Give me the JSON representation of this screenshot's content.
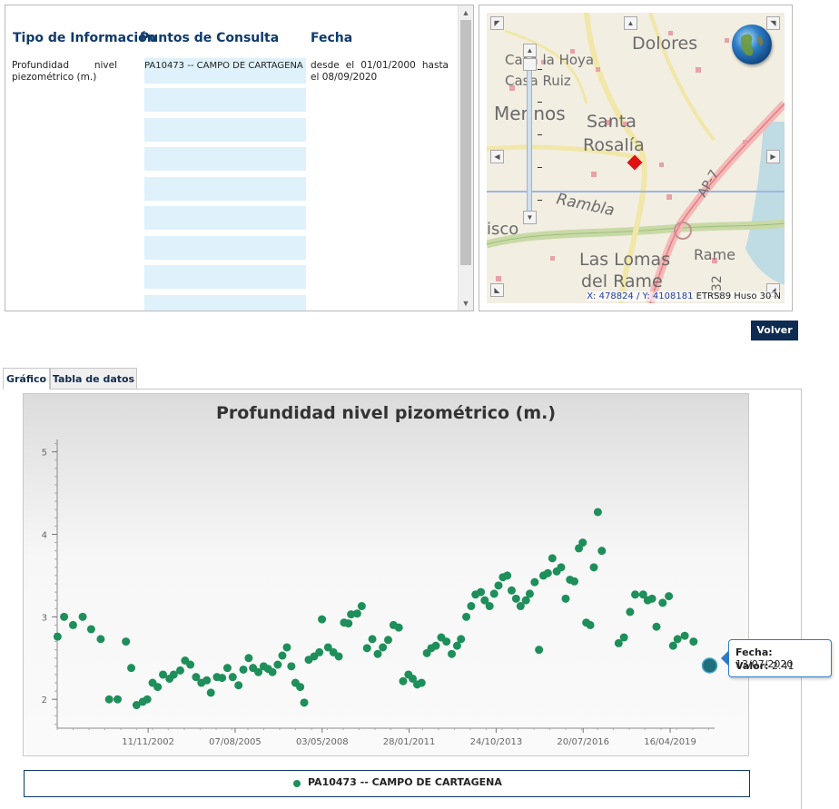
{
  "info_table": {
    "headers": {
      "type": "Tipo de Información",
      "points": "Puntos de Consulta",
      "date": "Fecha"
    },
    "type_value": "Profundidad nivel piezométrico (m.)",
    "point_value": "PA10473 -- CAMPO DE CARTAGENA",
    "date_value": "desde el 01/01/2000 hasta el 08/09/2020"
  },
  "map": {
    "labels": [
      "Dolores",
      "Casa la Hoya",
      "Casa Ruiz",
      "Merinos",
      "Santa",
      "Rosalía",
      "Rambla",
      "isco",
      "Las Lomas",
      "del Rame",
      "Rame",
      "AP-7",
      "332"
    ],
    "coord_x_label": "X:",
    "coord_x": "478824",
    "coord_y_label": "/ Y:",
    "coord_y": "4108181",
    "crs": "ETRS89 Huso 30 N"
  },
  "actions": {
    "volver": "Volver"
  },
  "tabs": [
    "Gráfico",
    "Tabla de datos"
  ],
  "legend": {
    "series_name": "PA10473 -- CAMPO DE CARTAGENA"
  },
  "tooltip": {
    "fecha_label": "Fecha:",
    "fecha": "13/07/2020",
    "valor_label": "Valor:",
    "valor": "2.41"
  },
  "colors": {
    "series": "#1e8f5a",
    "navy": "#0e2b52",
    "header_blue": "#0f3a6b",
    "row_bg": "#dff1fa"
  },
  "chart_data": {
    "type": "scatter",
    "title": "Profundidad nivel pizométrico (m.)",
    "xlabel": "",
    "ylabel": "",
    "ylim": [
      1.65,
      5.15
    ],
    "xlim": [
      "2000-01-01",
      "2020-09-08"
    ],
    "y_ticks": [
      2,
      3,
      4,
      5
    ],
    "x_ticks": [
      "11/11/2002",
      "07/08/2005",
      "03/05/2008",
      "28/01/2011",
      "24/10/2013",
      "20/07/2016",
      "16/04/2019"
    ],
    "series": [
      {
        "name": "PA10473 -- CAMPO DE CARTAGENA",
        "points": [
          [
            "2000-01-05",
            2.76
          ],
          [
            "2000-03-20",
            3.0
          ],
          [
            "2000-07-01",
            2.9
          ],
          [
            "2000-10-20",
            3.0
          ],
          [
            "2001-01-25",
            2.85
          ],
          [
            "2001-05-15",
            2.73
          ],
          [
            "2001-08-20",
            2.0
          ],
          [
            "2001-11-25",
            2.0
          ],
          [
            "2002-03-01",
            2.7
          ],
          [
            "2002-05-01",
            2.38
          ],
          [
            "2002-07-01",
            1.93
          ],
          [
            "2002-09-10",
            1.97
          ],
          [
            "2002-11-01",
            2.0
          ],
          [
            "2003-01-01",
            2.2
          ],
          [
            "2003-03-01",
            2.15
          ],
          [
            "2003-05-01",
            2.3
          ],
          [
            "2003-07-15",
            2.25
          ],
          [
            "2003-09-01",
            2.3
          ],
          [
            "2003-11-15",
            2.35
          ],
          [
            "2004-01-10",
            2.47
          ],
          [
            "2004-03-10",
            2.42
          ],
          [
            "2004-05-15",
            2.27
          ],
          [
            "2004-07-15",
            2.2
          ],
          [
            "2004-09-15",
            2.23
          ],
          [
            "2004-11-01",
            2.08
          ],
          [
            "2005-01-10",
            2.27
          ],
          [
            "2005-03-10",
            2.26
          ],
          [
            "2005-05-10",
            2.38
          ],
          [
            "2005-07-10",
            2.27
          ],
          [
            "2005-09-15",
            2.17
          ],
          [
            "2005-11-10",
            2.36
          ],
          [
            "2006-01-10",
            2.5
          ],
          [
            "2006-03-01",
            2.38
          ],
          [
            "2006-05-01",
            2.33
          ],
          [
            "2006-07-01",
            2.4
          ],
          [
            "2006-08-20",
            2.37
          ],
          [
            "2006-10-10",
            2.33
          ],
          [
            "2006-12-10",
            2.42
          ],
          [
            "2007-02-01",
            2.53
          ],
          [
            "2007-03-25",
            2.63
          ],
          [
            "2007-05-15",
            2.4
          ],
          [
            "2007-07-01",
            2.2
          ],
          [
            "2007-08-25",
            2.15
          ],
          [
            "2007-10-10",
            1.96
          ],
          [
            "2007-12-01",
            2.48
          ],
          [
            "2008-02-01",
            2.52
          ],
          [
            "2008-04-01",
            2.57
          ],
          [
            "2008-05-01",
            2.97
          ],
          [
            "2008-07-10",
            2.63
          ],
          [
            "2008-09-10",
            2.57
          ],
          [
            "2008-11-10",
            2.52
          ],
          [
            "2009-01-10",
            2.93
          ],
          [
            "2009-03-01",
            2.92
          ],
          [
            "2009-04-01",
            3.03
          ],
          [
            "2009-06-10",
            3.04
          ],
          [
            "2009-08-01",
            3.13
          ],
          [
            "2009-10-01",
            2.62
          ],
          [
            "2009-12-01",
            2.73
          ],
          [
            "2010-02-01",
            2.55
          ],
          [
            "2010-04-01",
            2.63
          ],
          [
            "2010-06-01",
            2.72
          ],
          [
            "2010-08-01",
            2.9
          ],
          [
            "2010-10-01",
            2.87
          ],
          [
            "2010-11-20",
            2.22
          ],
          [
            "2011-01-20",
            2.3
          ],
          [
            "2011-03-10",
            2.25
          ],
          [
            "2011-05-01",
            2.18
          ],
          [
            "2011-06-20",
            2.2
          ],
          [
            "2011-08-20",
            2.56
          ],
          [
            "2011-10-10",
            2.62
          ],
          [
            "2011-12-01",
            2.65
          ],
          [
            "2012-02-01",
            2.75
          ],
          [
            "2012-04-01",
            2.7
          ],
          [
            "2012-06-01",
            2.55
          ],
          [
            "2012-08-01",
            2.65
          ],
          [
            "2012-09-15",
            2.73
          ],
          [
            "2012-11-15",
            3.0
          ],
          [
            "2013-01-10",
            3.13
          ],
          [
            "2013-03-01",
            3.27
          ],
          [
            "2013-05-01",
            3.3
          ],
          [
            "2013-06-15",
            3.2
          ],
          [
            "2013-08-10",
            3.13
          ],
          [
            "2013-10-01",
            3.28
          ],
          [
            "2013-11-20",
            3.38
          ],
          [
            "2014-01-10",
            3.48
          ],
          [
            "2014-03-01",
            3.5
          ],
          [
            "2014-04-20",
            3.32
          ],
          [
            "2014-06-10",
            3.22
          ],
          [
            "2014-08-01",
            3.13
          ],
          [
            "2014-10-01",
            3.2
          ],
          [
            "2014-11-15",
            3.28
          ],
          [
            "2015-01-10",
            3.42
          ],
          [
            "2015-03-01",
            2.6
          ],
          [
            "2015-04-20",
            3.5
          ],
          [
            "2015-06-10",
            3.53
          ],
          [
            "2015-08-01",
            3.71
          ],
          [
            "2015-09-20",
            3.55
          ],
          [
            "2015-11-10",
            3.6
          ],
          [
            "2016-01-01",
            3.22
          ],
          [
            "2016-02-20",
            3.45
          ],
          [
            "2016-04-10",
            3.43
          ],
          [
            "2016-06-01",
            3.83
          ],
          [
            "2016-07-15",
            3.9
          ],
          [
            "2016-08-25",
            2.93
          ],
          [
            "2016-10-10",
            2.9
          ],
          [
            "2016-11-20",
            3.6
          ],
          [
            "2017-01-05",
            4.27
          ],
          [
            "2017-02-20",
            3.8
          ],
          [
            "2017-09-01",
            2.68
          ],
          [
            "2017-11-01",
            2.75
          ],
          [
            "2018-01-10",
            3.06
          ],
          [
            "2018-03-10",
            3.27
          ],
          [
            "2018-06-10",
            3.27
          ],
          [
            "2018-08-01",
            3.2
          ],
          [
            "2018-09-20",
            3.22
          ],
          [
            "2018-11-10",
            2.88
          ],
          [
            "2019-01-20",
            3.17
          ],
          [
            "2019-04-01",
            3.25
          ],
          [
            "2019-05-20",
            2.65
          ],
          [
            "2019-07-10",
            2.73
          ],
          [
            "2019-10-01",
            2.77
          ],
          [
            "2020-01-10",
            2.7
          ],
          [
            "2020-07-13",
            2.41
          ]
        ]
      }
    ],
    "highlighted_point": [
      "2020-07-13",
      2.41
    ]
  }
}
